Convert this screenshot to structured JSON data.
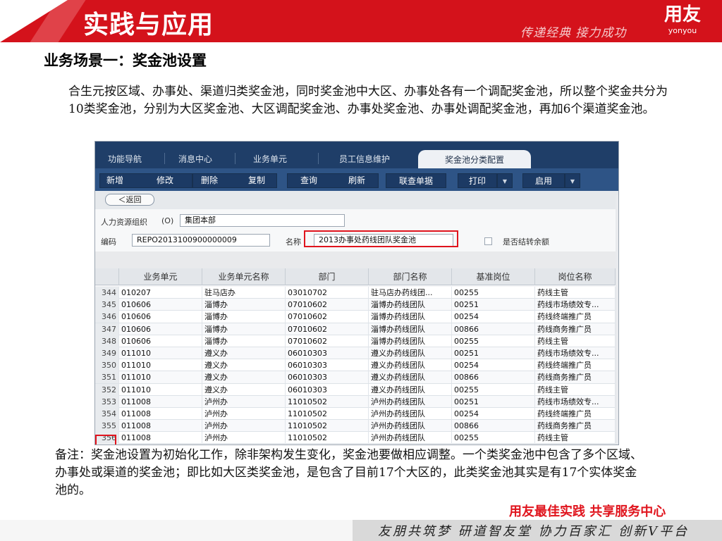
{
  "banner": {
    "title": "实践与应用",
    "slogan": "传递经典 接力成功",
    "logo_cn": "用友",
    "logo_en": "yonyou"
  },
  "scenario_title": "业务场景一：奖金池设置",
  "intro": "合生元按区域、办事处、渠道归类奖金池，同时奖金池中大区、办事处各有一个调配奖金池，所以整个奖金共分为10类奖金池，分别为大区奖金池、大区调配奖金池、办事处奖金池、办事处调配奖金池，再加6个渠道奖金池。",
  "app": {
    "tabs": [
      "功能导航",
      "消息中心",
      "业务单元",
      "员工信息维护",
      "奖金池分类配置"
    ],
    "toolbar": {
      "add": "新增",
      "edit": "修改",
      "delete": "删除",
      "copy": "复制",
      "query": "查询",
      "refresh": "刷新",
      "linked": "联查单据",
      "print": "打印",
      "enable": "启用",
      "caret": "▼"
    },
    "back": "＜返回",
    "form": {
      "org_label": "人力资源组织",
      "org_shortcut": "(O)",
      "org_value": "集团本部",
      "code_label": "编码",
      "code_value": "REPO2013100900000009",
      "name_label": "名称",
      "name_value": "2013办事处药线团队奖金池",
      "checkbox_label": "是否结转余额"
    },
    "columns": [
      "业务单元",
      "业务单元名称",
      "部门",
      "部门名称",
      "基准岗位",
      "岗位名称"
    ],
    "rows": [
      [
        "344",
        "010207",
        "驻马店办",
        "03010702",
        "驻马店办药线团...",
        "00255",
        "药线主管"
      ],
      [
        "345",
        "010606",
        "淄博办",
        "07010602",
        "淄博办药线团队",
        "00251",
        "药线市场绩效专..."
      ],
      [
        "346",
        "010606",
        "淄博办",
        "07010602",
        "淄博办药线团队",
        "00254",
        "药线终端推广员"
      ],
      [
        "347",
        "010606",
        "淄博办",
        "07010602",
        "淄博办药线团队",
        "00866",
        "药线商务推广员"
      ],
      [
        "348",
        "010606",
        "淄博办",
        "07010602",
        "淄博办药线团队",
        "00255",
        "药线主管"
      ],
      [
        "349",
        "011010",
        "遵义办",
        "06010303",
        "遵义办药线团队",
        "00251",
        "药线市场绩效专..."
      ],
      [
        "350",
        "011010",
        "遵义办",
        "06010303",
        "遵义办药线团队",
        "00254",
        "药线终端推广员"
      ],
      [
        "351",
        "011010",
        "遵义办",
        "06010303",
        "遵义办药线团队",
        "00866",
        "药线商务推广员"
      ],
      [
        "352",
        "011010",
        "遵义办",
        "06010303",
        "遵义办药线团队",
        "00255",
        "药线主管"
      ],
      [
        "353",
        "011008",
        "泸州办",
        "11010502",
        "泸州办药线团队",
        "00251",
        "药线市场绩效专..."
      ],
      [
        "354",
        "011008",
        "泸州办",
        "11010502",
        "泸州办药线团队",
        "00254",
        "药线终端推广员"
      ],
      [
        "355",
        "011008",
        "泸州办",
        "11010502",
        "泸州办药线团队",
        "00866",
        "药线商务推广员"
      ],
      [
        "356",
        "011008",
        "泸州办",
        "11010502",
        "泸州办药线团队",
        "00255",
        "药线主管"
      ]
    ]
  },
  "note": "备注：奖金池设置为初始化工作，除非架构发生变化，奖金池要做相应调整。一个类奖金池中包含了多个区域、办事处或渠道的奖金池；即比如大区类奖金池，是包含了目前17个大区的，此类奖金池其实是有17个实体奖金池的。",
  "tagline": "用友最佳实践 共享服务中心",
  "footer": "友朋共筑梦 研道智友堂 协力百家汇 创新V平台",
  "colors": {
    "brand_red": "#d4121b",
    "app_navy": "#1f3e68",
    "highlight": "#e0141d"
  }
}
